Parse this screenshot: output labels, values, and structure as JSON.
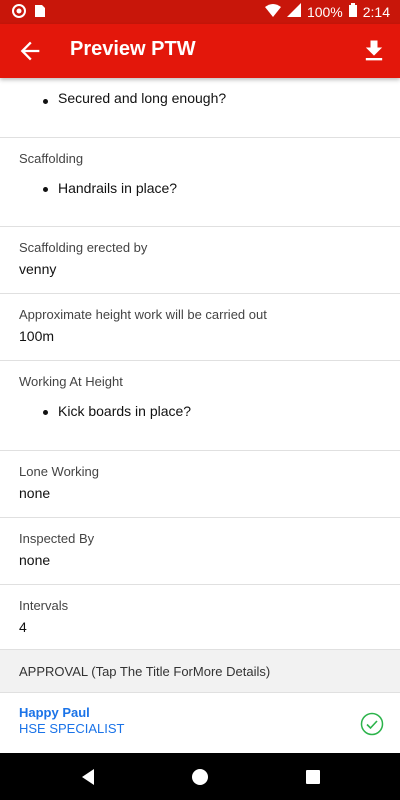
{
  "status_bar": {
    "battery": "100%",
    "time": "2:14"
  },
  "app_bar": {
    "title": "Preview PTW"
  },
  "sections": [
    {
      "label": "",
      "bullet": "Secured and long enough?"
    },
    {
      "label": "Scaffolding",
      "bullet": "Handrails in place?"
    },
    {
      "label": "Scaffolding erected by",
      "value": "venny"
    },
    {
      "label": "Approximate height work will be carried out",
      "value": "100m"
    },
    {
      "label": "Working At Height",
      "bullet": "Kick boards in place?"
    },
    {
      "label": "Lone Working",
      "value": "none"
    },
    {
      "label": "Inspected By",
      "value": "none"
    },
    {
      "label": "Intervals",
      "value": "4"
    }
  ],
  "approval": {
    "header": "APPROVAL (Tap The Title ForMore Details)",
    "approver": {
      "name": "Happy Paul",
      "role": "HSE SPECIALIST"
    }
  },
  "colors": {
    "appbar": "#e3170b",
    "statusbar": "#c8160a",
    "link": "#1a73e8",
    "check": "#2bb34a"
  }
}
